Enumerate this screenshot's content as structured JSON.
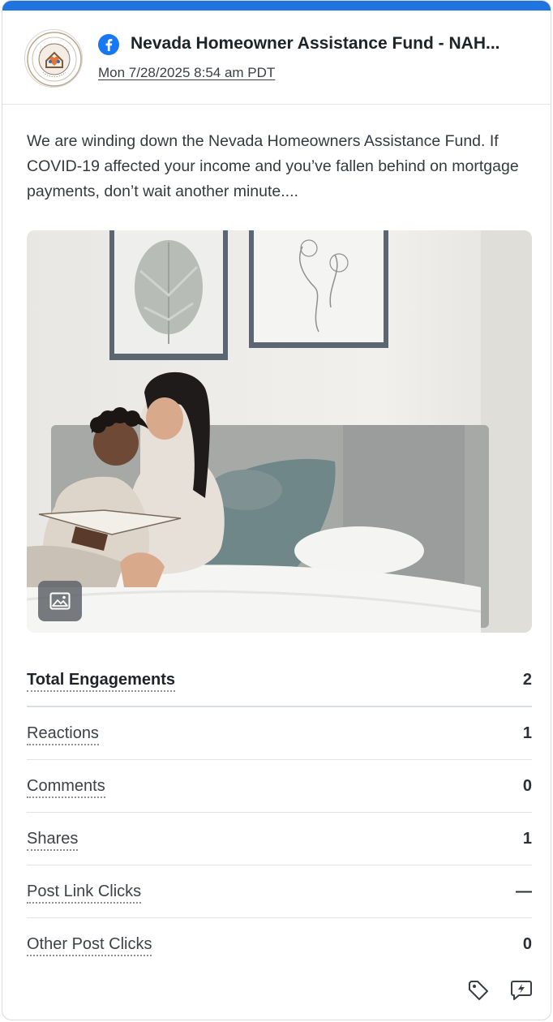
{
  "header": {
    "account_name": "Nevada Homeowner Assistance Fund - NAH...",
    "date": "Mon 7/28/2025 8:54 am PDT",
    "network_icon": "facebook-icon",
    "avatar_icon": "nahac-logo"
  },
  "post": {
    "text": "We are winding down the Nevada Homeowners Assistance Fund. If COVID-19 affected your income and you’ve fallen behind on mortgage payments, don’t wait another minute....",
    "image_badge_icon": "image-icon"
  },
  "metrics": [
    {
      "label": "Total Engagements",
      "value": "2"
    },
    {
      "label": "Reactions",
      "value": "1"
    },
    {
      "label": "Comments",
      "value": "0"
    },
    {
      "label": "Shares",
      "value": "1"
    },
    {
      "label": "Post Link Clicks",
      "value": "—"
    },
    {
      "label": "Other Post Clicks",
      "value": "0"
    }
  ],
  "footer": {
    "tag_icon": "tag-icon",
    "reply_icon": "reply-icon"
  },
  "colors": {
    "accent": "#1f74e0",
    "facebook": "#1877f2"
  }
}
